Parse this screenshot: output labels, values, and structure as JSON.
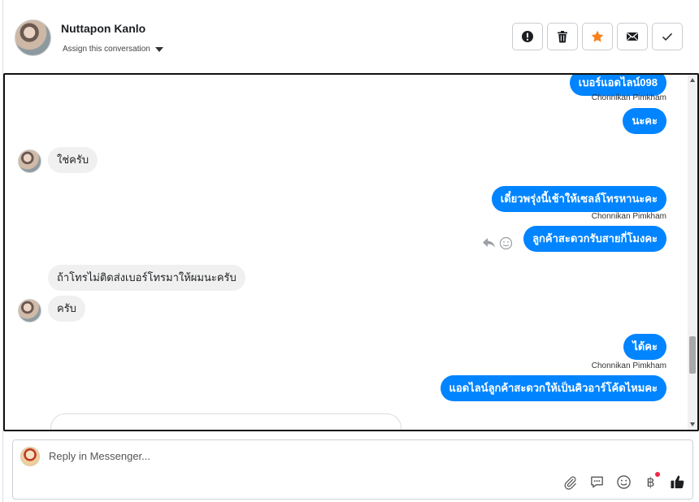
{
  "header": {
    "contact_name": "Nuttapon Kanlo",
    "assign_label": "Assign this conversation",
    "actions": [
      {
        "name": "mark-spam-button",
        "icon": "exclamation-circle-icon"
      },
      {
        "name": "delete-button",
        "icon": "trash-icon"
      },
      {
        "name": "star-button",
        "icon": "star-icon"
      },
      {
        "name": "mark-unread-button",
        "icon": "envelope-icon"
      },
      {
        "name": "mark-done-button",
        "icon": "checkmark-icon"
      }
    ]
  },
  "messages": {
    "m1": "เบอร์แอดไลน์098",
    "m1_sender": "Chonnikan Pimkham",
    "m2": "นะคะ",
    "m3": "ใช่ครับ",
    "m4": "เดี๋ยวพรุ่งนี้เช้าให้เซลล์โทรหานะคะ",
    "m4_sender": "Chonnikan Pimkham",
    "m5": "ลูกค้าสะดวกรับสายกี่โมงคะ",
    "m6": "ถ้าโทรไม่ติดส่งเบอร์โทรมาให้ผมนะครับ",
    "m7": "ครับ",
    "m8": "ได้คะ",
    "m8_sender": "Chonnikan Pimkham",
    "m9": "แอดไลน์ลูกค้าสะดวกให้เป็นคิวอาร์โค้ดไหมคะ"
  },
  "composer": {
    "placeholder": "Reply in Messenger...",
    "tools": [
      "paperclip-icon",
      "saved-reply-icon",
      "emoji-icon",
      "baht-payment-icon",
      "thumbs-up-icon"
    ],
    "baht_symbol": "฿"
  },
  "colors": {
    "outgoing_bubble": "#0084ff",
    "incoming_bubble": "#f0f0f0",
    "star": "#f5821f",
    "notification_dot": "#f02849"
  }
}
